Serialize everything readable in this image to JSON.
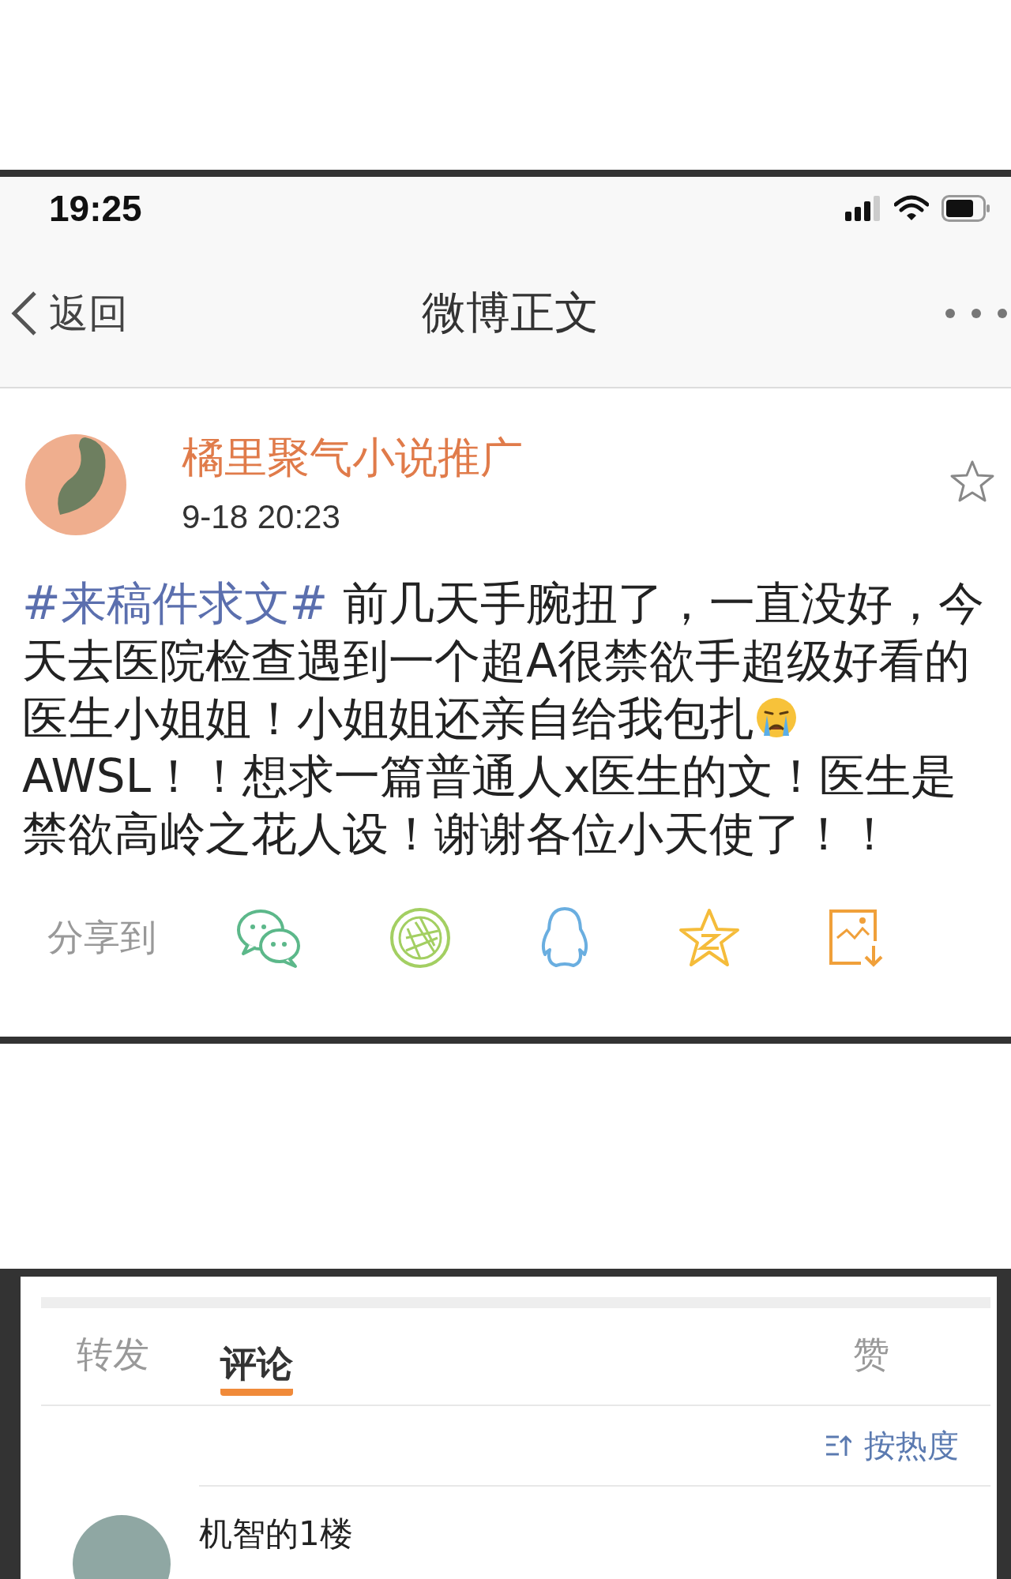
{
  "status_bar": {
    "time": "19:25"
  },
  "nav": {
    "back": "返回",
    "title": "微博正文"
  },
  "post": {
    "author": "橘里聚气小说推广",
    "time": "9-18  20:23",
    "starred": false,
    "hashtag": "#来稿件求文#",
    "text": " 前几天手腕扭了，一直没好，今天去医院检查遇到一个超A很禁欲手超级好看的医生小姐姐！小姐姐还亲自给我包扎",
    "text_after": "AWSL！！想求一篇普通人x医生的文！医生是禁欲高岭之花人设！谢谢各位小天使了！！"
  },
  "share": {
    "label": "分享到"
  },
  "tabs": [
    {
      "label": "转发",
      "selected": false
    },
    {
      "label": "评论",
      "selected": true
    },
    {
      "label": "赞",
      "selected": false
    }
  ],
  "sort": {
    "label": "按热度"
  },
  "comments": [
    {
      "author": "机智的1楼"
    }
  ]
}
